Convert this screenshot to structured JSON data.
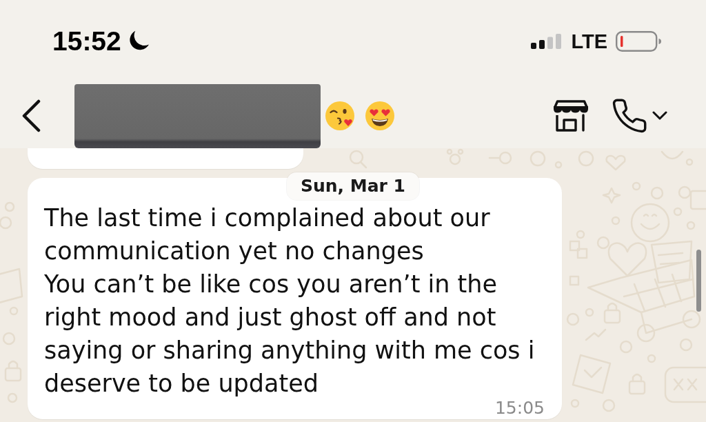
{
  "status_bar": {
    "time": "15:52",
    "do_not_disturb": true,
    "network": "LTE"
  },
  "chat": {
    "items": [
      {
        "kind": "clipped_bubble"
      },
      {
        "kind": "date",
        "text": "Sun, Mar 1"
      },
      {
        "kind": "message",
        "text": "The last time i complained about our communication yet no changes\nYou can’t be like cos you aren’t in the right mood and just ghost off and not saying or sharing anything with me cos i deserve to be updated",
        "time": "15:05"
      }
    ]
  }
}
